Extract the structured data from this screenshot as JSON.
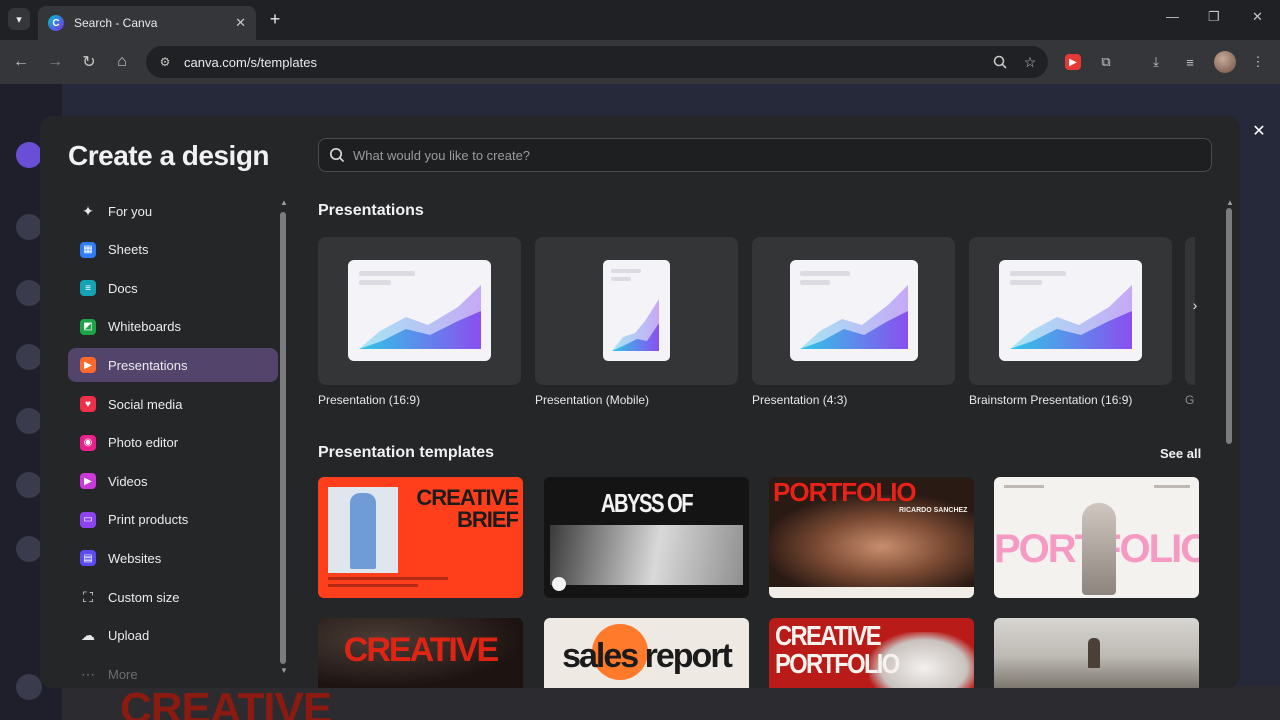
{
  "browser": {
    "tab_title": "Search - Canva",
    "favicon_letter": "C",
    "url": "canva.com/s/templates",
    "accent_colors": {
      "canva_start": "#00c4cc",
      "canva_end": "#7d2ae8",
      "extension_red": "#e53935"
    }
  },
  "dialog": {
    "title": "Create a design",
    "search_placeholder": "What would you like to create?",
    "sidebar": [
      {
        "label": "For you",
        "icon": "sparkles-icon",
        "color": "#2b2c2f"
      },
      {
        "label": "Sheets",
        "icon": "sheets-icon",
        "color": "#2f7cf6"
      },
      {
        "label": "Docs",
        "icon": "docs-icon",
        "color": "#13a3b5"
      },
      {
        "label": "Whiteboards",
        "icon": "whiteboards-icon",
        "color": "#1ea446"
      },
      {
        "label": "Presentations",
        "icon": "presentations-icon",
        "color": "#ff6a2b",
        "active": true
      },
      {
        "label": "Social media",
        "icon": "social-media-icon",
        "color": "#ef2f4a"
      },
      {
        "label": "Photo editor",
        "icon": "photo-editor-icon",
        "color": "#e8208a"
      },
      {
        "label": "Videos",
        "icon": "videos-icon",
        "color": "#c93ad8"
      },
      {
        "label": "Print products",
        "icon": "print-products-icon",
        "color": "#8c44f0"
      },
      {
        "label": "Websites",
        "icon": "websites-icon",
        "color": "#5a4cf0"
      },
      {
        "label": "Custom size",
        "icon": "custom-size-icon",
        "color": "#2b2c2f"
      },
      {
        "label": "Upload",
        "icon": "upload-icon",
        "color": "#2b2c2f"
      },
      {
        "label": "More",
        "icon": "more-icon",
        "color": "#2b2c2f"
      }
    ],
    "presentations_heading": "Presentations",
    "presets": [
      {
        "label": "Presentation (16:9)"
      },
      {
        "label": "Presentation (Mobile)"
      },
      {
        "label": "Presentation (4:3)"
      },
      {
        "label": "Brainstorm Presentation (16:9)"
      }
    ],
    "preset_overflow_label": "G",
    "templates_heading": "Presentation templates",
    "see_all": "See all",
    "templates": [
      {
        "name": "creative-brief",
        "text_lines": [
          "CREATIVE",
          "BRIEF"
        ]
      },
      {
        "name": "abyss-of-deceptions",
        "text_lines": [
          "ABYSS OF DECEPTIONS"
        ]
      },
      {
        "name": "portfolio-ricardo",
        "text_lines": [
          "PORTFOLIO",
          "RICARDO SANCHEZ"
        ]
      },
      {
        "name": "portfolio-pink",
        "text_lines": [
          "PORTFOLIO"
        ]
      },
      {
        "name": "creative-dark",
        "text_lines": [
          "CREATIVE"
        ]
      },
      {
        "name": "sales-report",
        "text_lines": [
          "sales report"
        ]
      },
      {
        "name": "creative-portfolio-red",
        "text_lines": [
          "CREATIVE",
          "PORTFOLIO"
        ]
      },
      {
        "name": "landscape-photo",
        "text_lines": []
      }
    ]
  },
  "background_page": {
    "creative_text": "CREATIVE"
  }
}
